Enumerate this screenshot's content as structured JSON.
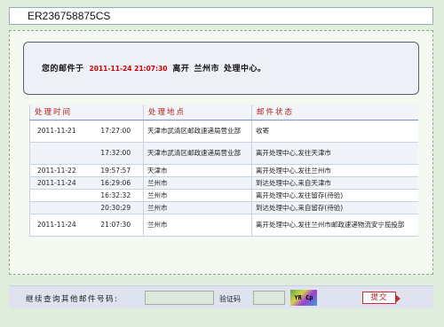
{
  "tracking_number": "ER236758875CS",
  "summary": {
    "prefix": "您的邮件于",
    "datetime": "2011-11-24 21:07:30",
    "action": "离开",
    "city": "兰州市",
    "facility": "处理中心。"
  },
  "table": {
    "headers": [
      "处理时间",
      "处理地点",
      "邮件状态"
    ],
    "rows": [
      {
        "date": "2011-11-21",
        "time": "17:27:00",
        "location": "天津市武清区邮政速递局营业部",
        "status": "收寄"
      },
      {
        "date": "",
        "time": "17:32:00",
        "location": "天津市武清区邮政速递局营业部",
        "status": "离开处理中心,发往天津市"
      },
      {
        "date": "2011-11-22",
        "time": "19:57:57",
        "location": "天津市",
        "status": "离开处理中心,发往兰州市"
      },
      {
        "date": "2011-11-24",
        "time": "16:29:06",
        "location": "兰州市",
        "status": "到达处理中心,来自天津市"
      },
      {
        "date": "",
        "time": "16:32:32",
        "location": "兰州市",
        "status": "离开处理中心,发往留存(待验)"
      },
      {
        "date": "",
        "time": "20:30:29",
        "location": "兰州市",
        "status": "到达处理中心,来自留存(待验)"
      },
      {
        "date": "2011-11-24",
        "time": "21:07:30",
        "location": "兰州市",
        "status": "离开处理中心,发往兰州市邮政速递物流安宁揽投部"
      }
    ]
  },
  "query": {
    "label": "继续查询其他邮件号码:",
    "code_label": "验证码",
    "captcha_text": "YR Cp",
    "submit_label": "提交"
  },
  "colors": {
    "background": "#dfeedd",
    "header_text": "#b3221b",
    "highlight_date": "#cc0000"
  }
}
